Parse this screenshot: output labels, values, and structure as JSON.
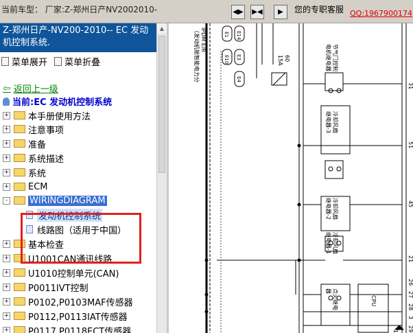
{
  "topbar": {
    "car_label": "当前车型：  厂家:Z-郑州日产NV2002010-",
    "nav_buttons": [
      {
        "glyph": "◀▶"
      },
      {
        "glyph": "▶◀"
      },
      {
        "glyph": "▶"
      }
    ],
    "service_label": "您的专职客服",
    "qq_link": "QQ:1967900174"
  },
  "sidebar": {
    "title": "Z-郑州日产-NV200-2010-- EC 发动机控制系统.",
    "expand_label": "菜单展开",
    "collapse_label": "菜单折叠",
    "back_label": "返回上一级",
    "current_label": "当前:EC 发动机控制系统",
    "tree": [
      {
        "label": "本手册使用方法",
        "exp": "+"
      },
      {
        "label": "注意事项",
        "exp": "+"
      },
      {
        "label": "准备",
        "exp": "+"
      },
      {
        "label": "系统描述",
        "exp": "+"
      },
      {
        "label": "系统",
        "exp": "+"
      },
      {
        "label": "ECM",
        "exp": "+"
      },
      {
        "label": "WIRINGDIAGRAM",
        "exp": "-"
      },
      {
        "label": "发动机控制系统",
        "child": true
      },
      {
        "label": "线路图（适用于中国）",
        "child": true
      },
      {
        "label": "基本检查",
        "exp": "+"
      },
      {
        "label": "U1001CAN通讯线路",
        "exp": "+"
      },
      {
        "label": "U1010控制单元(CAN)",
        "exp": "+"
      },
      {
        "label": "P0011IVT控制",
        "exp": "+"
      },
      {
        "label": "P0102,P0103MAF传感器",
        "exp": "+"
      },
      {
        "label": "P0112,P0113IAT传感器",
        "exp": "+"
      },
      {
        "label": "P0117,P0118ECT传感器",
        "exp": "+"
      }
    ]
  },
  "diagram": {
    "labels": {
      "ipdm": "IPDM E/R",
      "ipdm_sub": "（发动机舱智能电力分",
      "e1": "E1",
      "e14": "E14",
      "e10": "E10",
      "e3": "E3",
      "e4": "E4",
      "fuse": "15A",
      "fuse_no": "60",
      "relay1": "节气门控制",
      "relay1b": "电机继电器",
      "relay2": "冷却风扇",
      "relay2b": "继电器-3",
      "relay3": "冷却风扇",
      "relay3b": "继电器-2",
      "relay4": "冷却风扇",
      "relay4b": "继电器-1",
      "relay5": "点火继电",
      "relay5b": "器",
      "cpu": "CPU",
      "pin31": "31",
      "pin51": "51",
      "pin45": "45",
      "pin21": "21",
      "pin26": "26",
      "pin27": "27",
      "pin28": "28",
      "pin3": "3",
      "pin29": "29",
      "pin14": "14"
    }
  }
}
